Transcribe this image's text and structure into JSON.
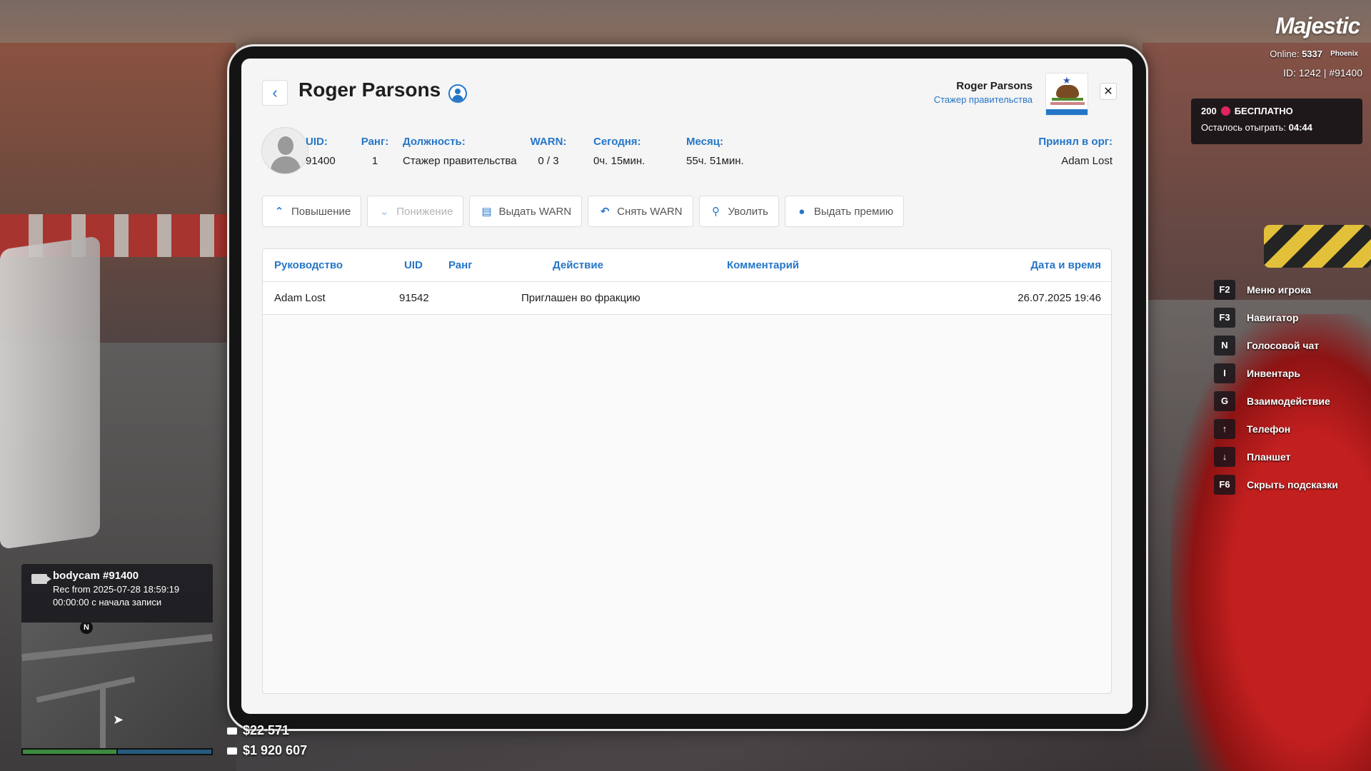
{
  "profile": {
    "name": "Roger Parsons",
    "header_name": "Roger Parsons",
    "header_role": "Стажер правительства"
  },
  "info": {
    "uid_label": "UID:",
    "uid_value": "91400",
    "rank_label": "Ранг:",
    "rank_value": "1",
    "position_label": "Должность:",
    "position_value": "Стажер правительства",
    "warn_label": "WARN:",
    "warn_value": "0 / 3",
    "today_label": "Сегодня:",
    "today_value": "0ч. 15мин.",
    "month_label": "Месяц:",
    "month_value": "55ч. 51мин.",
    "accepted_label": "Принял в орг:",
    "accepted_value": "Adam Lost"
  },
  "actions": {
    "promote": "Повышение",
    "demote": "Понижение",
    "give_warn": "Выдать WARN",
    "remove_warn": "Снять WARN",
    "fire": "Уволить",
    "bonus": "Выдать премию"
  },
  "table": {
    "headers": [
      "Руководство",
      "UID",
      "Ранг",
      "Действие",
      "Комментарий",
      "Дата и время"
    ],
    "rows": [
      {
        "leader": "Adam Lost",
        "uid": "91542",
        "rank": "",
        "action": "Приглашен во фракцию",
        "comment": "",
        "datetime": "26.07.2025 19:46"
      }
    ]
  },
  "hud": {
    "logo": "Majestic",
    "online_label": "Online:",
    "online_value": "5337",
    "server": "Phoenix",
    "id_line": "ID: 1242 | #91400",
    "bonus_amount": "200",
    "bonus_text": "БЕСПЛАТНО",
    "bonus_remaining_label": "Осталось отыграть:",
    "bonus_remaining_value": "04:44",
    "hints": [
      {
        "key": "F2",
        "label": "Меню игрока"
      },
      {
        "key": "F3",
        "label": "Навигатор"
      },
      {
        "key": "N",
        "label": "Голосовой чат"
      },
      {
        "key": "I",
        "label": "Инвентарь"
      },
      {
        "key": "G",
        "label": "Взаимодействие"
      },
      {
        "key": "↑",
        "label": "Телефон"
      },
      {
        "key": "↓",
        "label": "Планшет"
      },
      {
        "key": "F6",
        "label": "Скрыть подсказки"
      }
    ],
    "bodycam_title": "bodycam #91400",
    "bodycam_rec": "Rec from 2025-07-28 18:59:19",
    "bodycam_elapsed": "00:00:00 с начала записи",
    "minimap_north": "N",
    "cash": "$22 571",
    "bank": "$1 920 607"
  },
  "colors": {
    "accent": "#2576c8",
    "text": "#1e1e1e",
    "panel": "#f5f5f5"
  }
}
